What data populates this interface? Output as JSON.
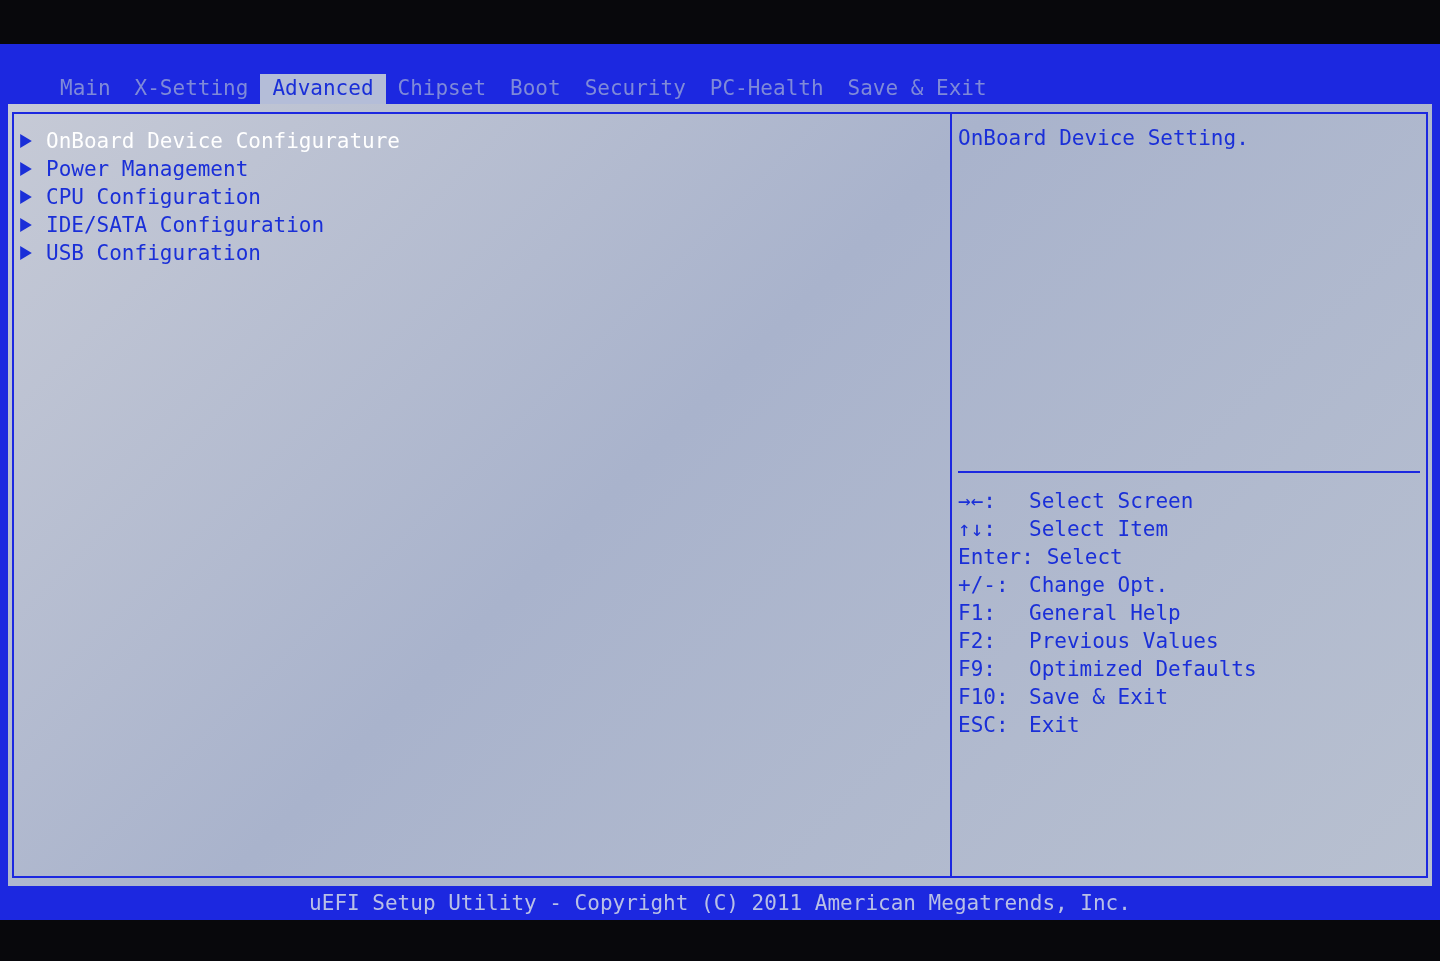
{
  "tabs": [
    {
      "label": "Main",
      "selected": false
    },
    {
      "label": "X-Setting",
      "selected": false
    },
    {
      "label": "Advanced",
      "selected": true
    },
    {
      "label": "Chipset",
      "selected": false
    },
    {
      "label": "Boot",
      "selected": false
    },
    {
      "label": "Security",
      "selected": false
    },
    {
      "label": "PC-Health",
      "selected": false
    },
    {
      "label": "Save & Exit",
      "selected": false
    }
  ],
  "menu": [
    {
      "label": "OnBoard Device Configurature",
      "selected": true
    },
    {
      "label": "Power Management",
      "selected": false
    },
    {
      "label": "CPU Configuration",
      "selected": false
    },
    {
      "label": "IDE/SATA Configuration",
      "selected": false
    },
    {
      "label": "USB Configuration",
      "selected": false
    }
  ],
  "help": {
    "description": "OnBoard Device Setting.",
    "keys": [
      {
        "key": "→←:",
        "action": "Select Screen"
      },
      {
        "key": "↑↓:",
        "action": "Select Item"
      },
      {
        "key": "Enter:",
        "action": "Select"
      },
      {
        "key": "+/-:",
        "action": "Change Opt."
      },
      {
        "key": "F1:",
        "action": "General Help"
      },
      {
        "key": "F2:",
        "action": "Previous Values"
      },
      {
        "key": "F9:",
        "action": "Optimized Defaults"
      },
      {
        "key": "F10:",
        "action": "Save & Exit"
      },
      {
        "key": "ESC:",
        "action": "Exit"
      }
    ]
  },
  "footer": "uEFI Setup Utility - Copyright (C) 2011 American Megatrends, Inc."
}
